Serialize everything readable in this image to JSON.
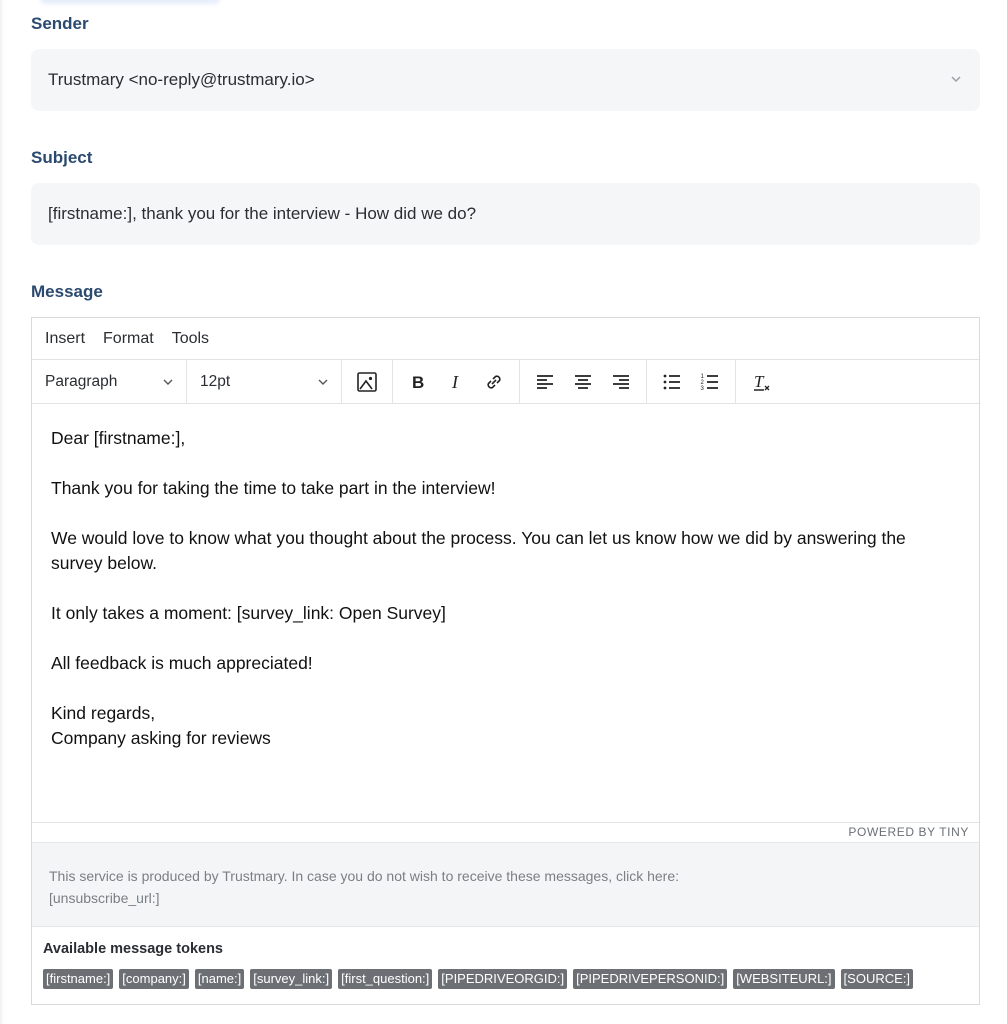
{
  "colors": {
    "label": "#2b4a6f",
    "field_bg": "#f5f6f7",
    "token_bg": "#6c7075",
    "footer_bg": "#f4f5f6"
  },
  "sender": {
    "label": "Sender",
    "value": "Trustmary <no-reply@trustmary.io>"
  },
  "subject": {
    "label": "Subject",
    "value": "[firstname:], thank you for the interview - How did we do?"
  },
  "message": {
    "label": "Message",
    "menubar": [
      "Insert",
      "Format",
      "Tools"
    ],
    "toolbar": {
      "block_format": "Paragraph",
      "font_size": "12pt"
    },
    "body": [
      "Dear [firstname:],",
      "Thank you for taking the time to take part in the interview!",
      "We would love to know what you thought about the process. You can let us know how we did by answering the survey below.",
      "It only takes a moment: [survey_link: Open Survey]",
      "All feedback is much appreciated!",
      "Kind regards,",
      "Company asking for reviews"
    ],
    "status": "POWERED BY TINY",
    "footer_line1": "This service is produced by Trustmary. In case you do not wish to receive these messages, click here:",
    "footer_line2": "[unsubscribe_url:]"
  },
  "tokens": {
    "title": "Available message tokens",
    "items": [
      "[firstname:]",
      "[company:]",
      "[name:]",
      "[survey_link:]",
      "[first_question:]",
      "[PIPEDRIVEORGID:]",
      "[PIPEDRIVEPERSONID:]",
      "[WEBSITEURL:]",
      "[SOURCE:]"
    ]
  }
}
